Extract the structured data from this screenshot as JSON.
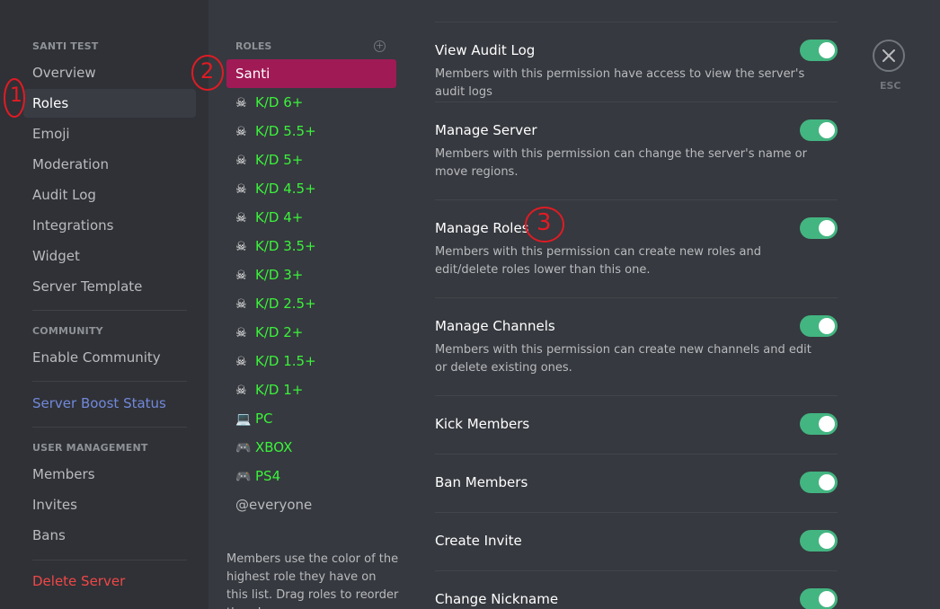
{
  "sidebar": {
    "server_header": "SANTI TEST",
    "items": [
      {
        "label": "Overview"
      },
      {
        "label": "Roles"
      },
      {
        "label": "Emoji"
      },
      {
        "label": "Moderation"
      },
      {
        "label": "Audit Log"
      },
      {
        "label": "Integrations"
      },
      {
        "label": "Widget"
      },
      {
        "label": "Server Template"
      }
    ],
    "community_header": "COMMUNITY",
    "community_items": [
      {
        "label": "Enable Community"
      }
    ],
    "boost_label": "Server Boost Status",
    "user_mgmt_header": "USER MANAGEMENT",
    "user_items": [
      {
        "label": "Members"
      },
      {
        "label": "Invites"
      },
      {
        "label": "Bans"
      }
    ],
    "delete_label": "Delete Server",
    "active_item": "Roles"
  },
  "roles": {
    "header": "ROLES",
    "add_glyph": "+",
    "list": [
      {
        "name": "Santi",
        "icon": "",
        "color": "#ffffff"
      },
      {
        "name": "K/D 6+",
        "icon": "☠",
        "color": "#3bf23b"
      },
      {
        "name": "K/D 5.5+",
        "icon": "☠",
        "color": "#3bf23b"
      },
      {
        "name": "K/D 5+",
        "icon": "☠",
        "color": "#3bf23b"
      },
      {
        "name": "K/D 4.5+",
        "icon": "☠",
        "color": "#3bf23b"
      },
      {
        "name": "K/D 4+",
        "icon": "☠",
        "color": "#3bf23b"
      },
      {
        "name": "K/D 3.5+",
        "icon": "☠",
        "color": "#3bf23b"
      },
      {
        "name": "K/D 3+",
        "icon": "☠",
        "color": "#3bf23b"
      },
      {
        "name": "K/D 2.5+",
        "icon": "☠",
        "color": "#3bf23b"
      },
      {
        "name": "K/D 2+",
        "icon": "☠",
        "color": "#3bf23b"
      },
      {
        "name": "K/D 1.5+",
        "icon": "☠",
        "color": "#3bf23b"
      },
      {
        "name": "K/D 1+",
        "icon": "☠",
        "color": "#3bf23b"
      },
      {
        "name": "PC",
        "icon": "💻",
        "color": "#3bf23b"
      },
      {
        "name": "XBOX",
        "icon": "🎮",
        "color": "#3bf23b"
      },
      {
        "name": "PS4",
        "icon": "🎮",
        "color": "#3bf23b"
      },
      {
        "name": "@everyone",
        "icon": "",
        "color": "#b9bbbe"
      }
    ],
    "selected": "Santi",
    "selected_bg": "#a01a56",
    "hint": "Members use the color of the highest role they have on this list. Drag roles to reorder them!"
  },
  "permissions": [
    {
      "title": "View Audit Log",
      "desc": "Members with this permission have access to view the server's audit logs",
      "enabled": true
    },
    {
      "title": "Manage Server",
      "desc": "Members with this permission can change the server's name or move regions.",
      "enabled": true
    },
    {
      "title": "Manage Roles",
      "desc": "Members with this permission can create new roles and edit/delete roles lower than this one.",
      "enabled": true
    },
    {
      "title": "Manage Channels",
      "desc": "Members with this permission can create new channels and edit or delete existing ones.",
      "enabled": true
    },
    {
      "title": "Kick Members",
      "desc": "",
      "enabled": true
    },
    {
      "title": "Ban Members",
      "desc": "",
      "enabled": true
    },
    {
      "title": "Create Invite",
      "desc": "",
      "enabled": true
    },
    {
      "title": "Change Nickname",
      "desc": "",
      "enabled": true
    }
  ],
  "close": {
    "esc_label": "ESC",
    "icon": "close-icon"
  },
  "annotations": {
    "one": "1",
    "two": "2",
    "three": "3",
    "color": "#e01b24"
  },
  "colors": {
    "toggle_on": "#43b581",
    "boost": "#7289da",
    "danger": "#f04747"
  }
}
